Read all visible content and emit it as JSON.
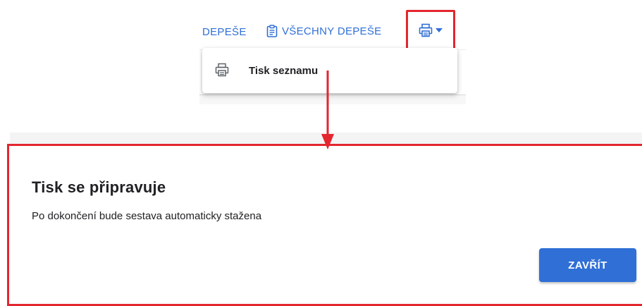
{
  "toolbar": {
    "depese_label": "DEPEŠE",
    "all_depese_label": "VŠECHNY DEPEŠE",
    "print_icon": "printer-icon",
    "dropdown_icon": "caret-down-icon",
    "all_depese_icon": "clipboard-icon"
  },
  "menu": {
    "items": [
      {
        "label": "Tisk seznamu",
        "icon": "printer-icon"
      }
    ]
  },
  "dialog": {
    "title": "Tisk se připravuje",
    "message": "Po dokončení bude sestava automaticky stažena",
    "close_label": "ZAVŘÍT"
  },
  "colors": {
    "accent": "#2f6fd6",
    "highlight": "#e3262f",
    "text": "#202124"
  }
}
